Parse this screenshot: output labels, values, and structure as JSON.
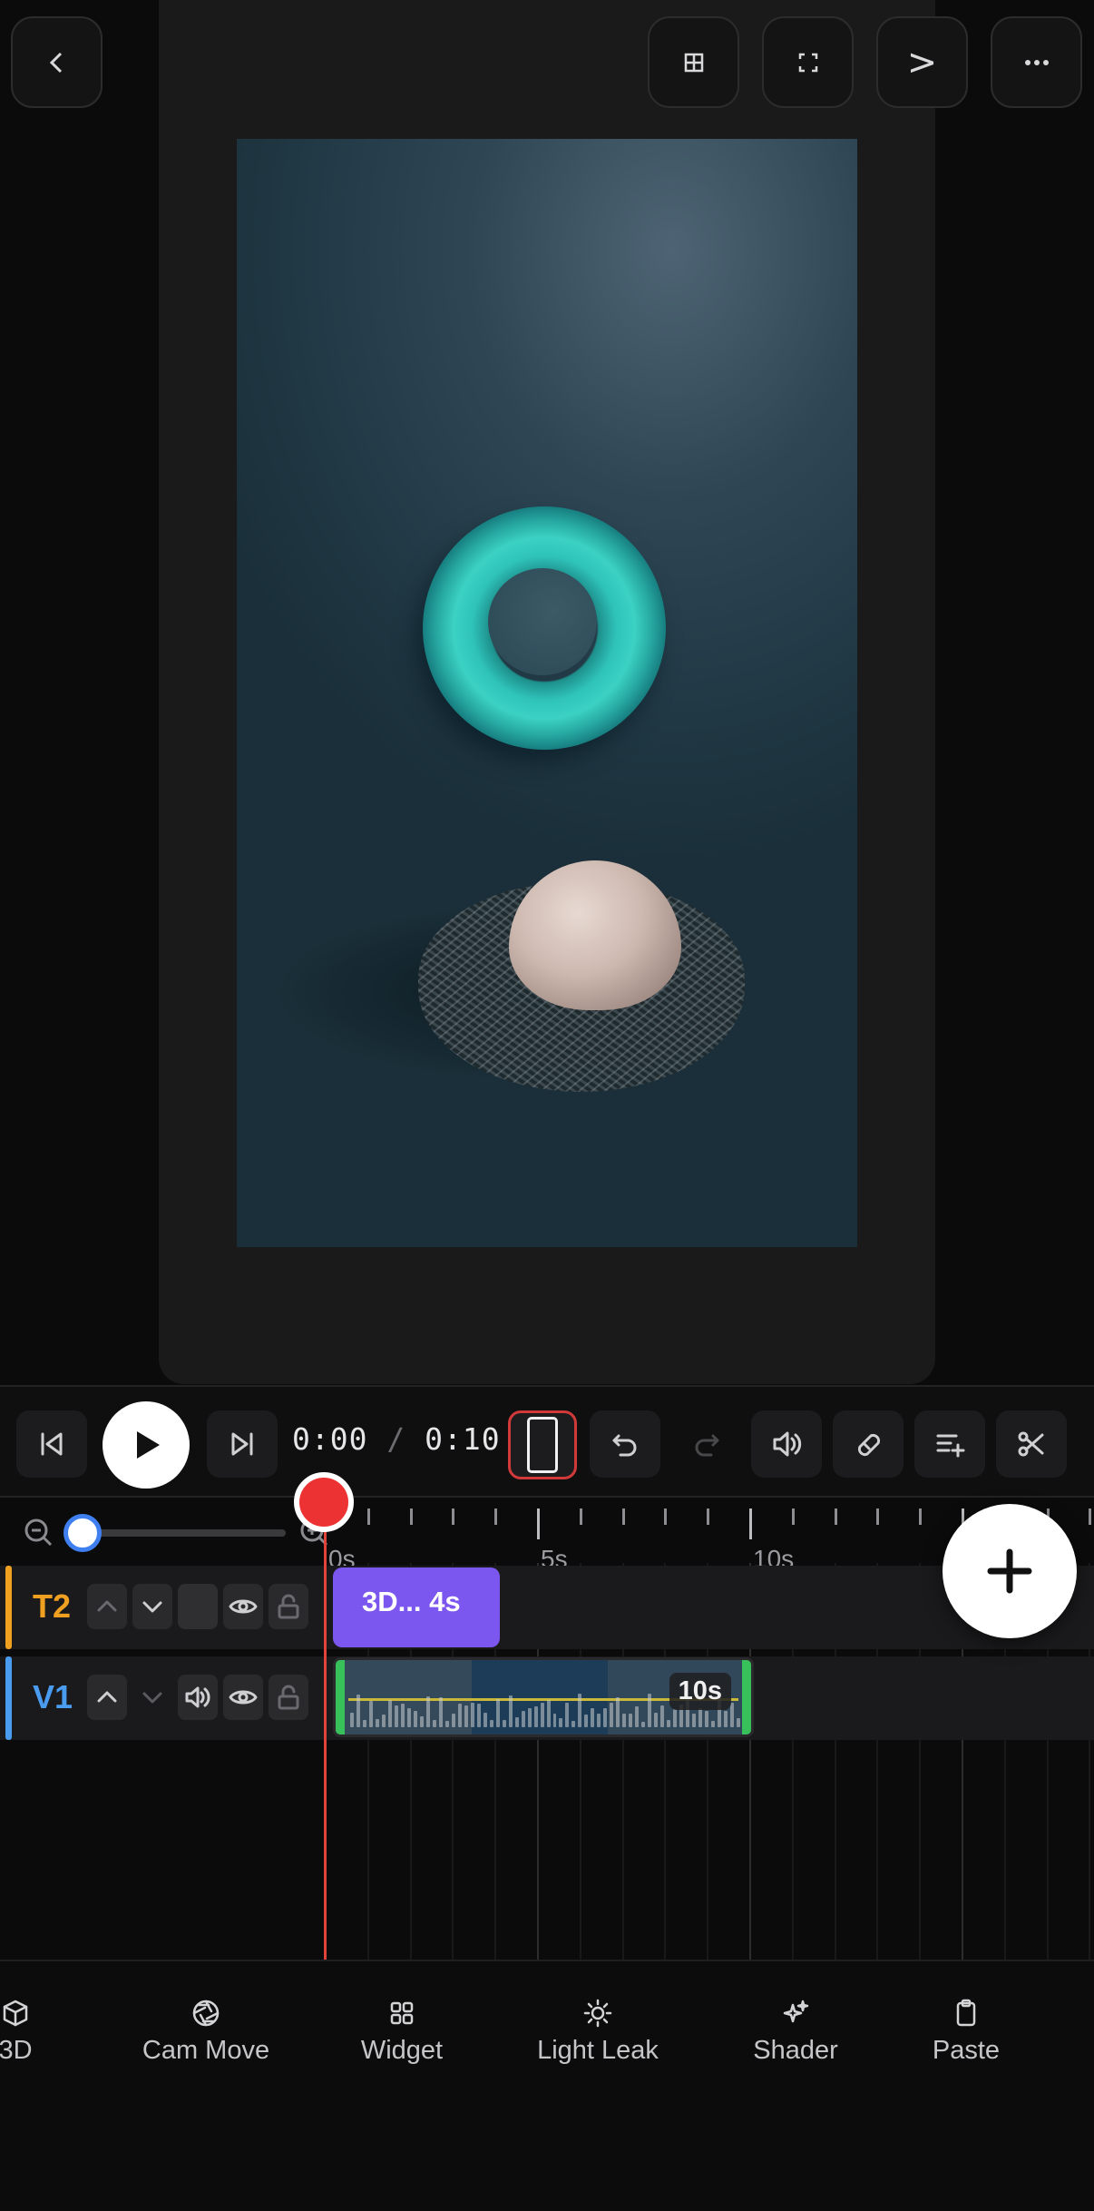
{
  "header": {
    "back_icon": "chevron-left-icon",
    "buttons": [
      {
        "icon": "grid-icon"
      },
      {
        "icon": "fullscreen-icon"
      },
      {
        "glyph": ">"
      },
      {
        "icon": "more-horizontal-icon"
      }
    ]
  },
  "preview": {
    "scene": "teal torus floating above an egg in a nest on a dark blue-green background"
  },
  "transport": {
    "current_time": "0:00",
    "separator": "/",
    "total_time": "0:10",
    "aspect_ratio_selected": "9:16"
  },
  "timeline": {
    "ruler_labels": [
      "0s",
      "5s",
      "10s"
    ],
    "zoom_level": 0.05,
    "tracks": [
      {
        "name": "T2",
        "color": "#f0a020",
        "clip_label": "3D... 4s"
      },
      {
        "name": "V1",
        "color": "#4a9cf0",
        "clip_duration": "10s"
      }
    ]
  },
  "toolbar": {
    "items": [
      {
        "label": "3D",
        "icon": "cube-icon"
      },
      {
        "label": "Cam Move",
        "icon": "aperture-icon"
      },
      {
        "label": "Widget",
        "icon": "widget-grid-icon"
      },
      {
        "label": "Light Leak",
        "icon": "sun-icon"
      },
      {
        "label": "Shader",
        "icon": "sparkles-icon"
      },
      {
        "label": "Paste",
        "icon": "clipboard-icon"
      }
    ]
  },
  "colors": {
    "accent_blue": "#3f7ff0",
    "playhead_red": "#ec3232",
    "text_clip_purple": "#7b56ef",
    "handle_green": "#38c05a"
  }
}
